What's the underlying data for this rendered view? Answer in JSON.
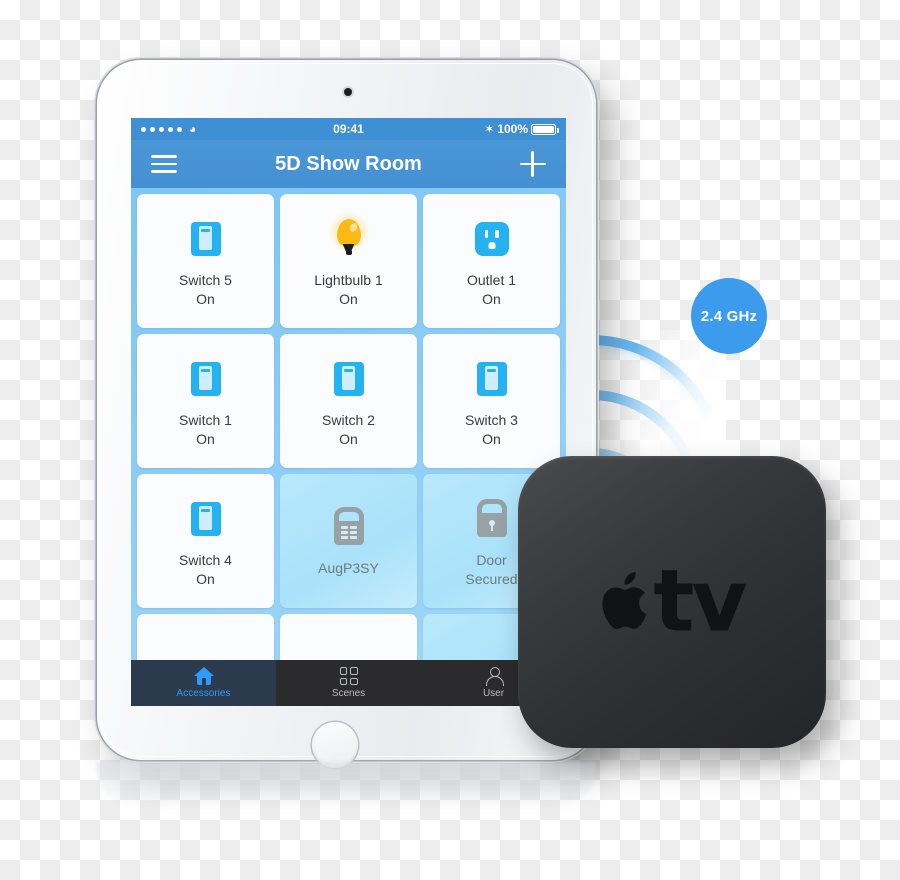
{
  "scene": {
    "badge": {
      "label": "2.4 GHz",
      "color": "#3d9bee"
    },
    "apple_tv": {
      "wordmark": "tv",
      "logo_icon": "apple-logo-icon"
    }
  },
  "tablet": {
    "status_bar": {
      "signal_dots": 5,
      "wifi_icon": "wifi-icon",
      "time": "09:41",
      "bluetooth_icon": "bluetooth-icon",
      "bluetooth_glyph": "✶",
      "battery_percent": "100%"
    },
    "nav_bar": {
      "menu_icon": "hamburger-menu-icon",
      "title": "5D Show Room",
      "add_icon": "plus-icon"
    },
    "accessories": [
      {
        "name": "Switch 5",
        "state": "On",
        "icon": "switch-icon",
        "available": true
      },
      {
        "name": "Lightbulb 1",
        "state": "On",
        "icon": "lightbulb-icon",
        "available": true
      },
      {
        "name": "Outlet 1",
        "state": "On",
        "icon": "outlet-icon",
        "available": true
      },
      {
        "name": "Switch 1",
        "state": "On",
        "icon": "switch-icon",
        "available": true
      },
      {
        "name": "Switch 2",
        "state": "On",
        "icon": "switch-icon",
        "available": true
      },
      {
        "name": "Switch 3",
        "state": "On",
        "icon": "switch-icon",
        "available": true
      },
      {
        "name": "Switch 4",
        "state": "On",
        "icon": "switch-icon",
        "available": true
      },
      {
        "name": "AugP3SY",
        "state": "",
        "icon": "lock-keypad-icon",
        "available": false
      },
      {
        "name": "Door",
        "state": "Secured",
        "icon": "lock-keyhole-icon",
        "available": false
      }
    ],
    "partial_row": [
      {
        "icon": "sensor-icon",
        "available": true
      },
      {
        "icon": "sensor-icon",
        "available": true
      },
      {
        "icon": "sensor-icon",
        "available": false
      }
    ],
    "tab_bar": {
      "active_color": "#2f9bff",
      "tabs": [
        {
          "label": "Accessories",
          "icon": "home-icon",
          "active": true
        },
        {
          "label": "Scenes",
          "icon": "grid-icon",
          "active": false
        },
        {
          "label": "User",
          "icon": "user-icon",
          "active": false
        }
      ]
    }
  }
}
